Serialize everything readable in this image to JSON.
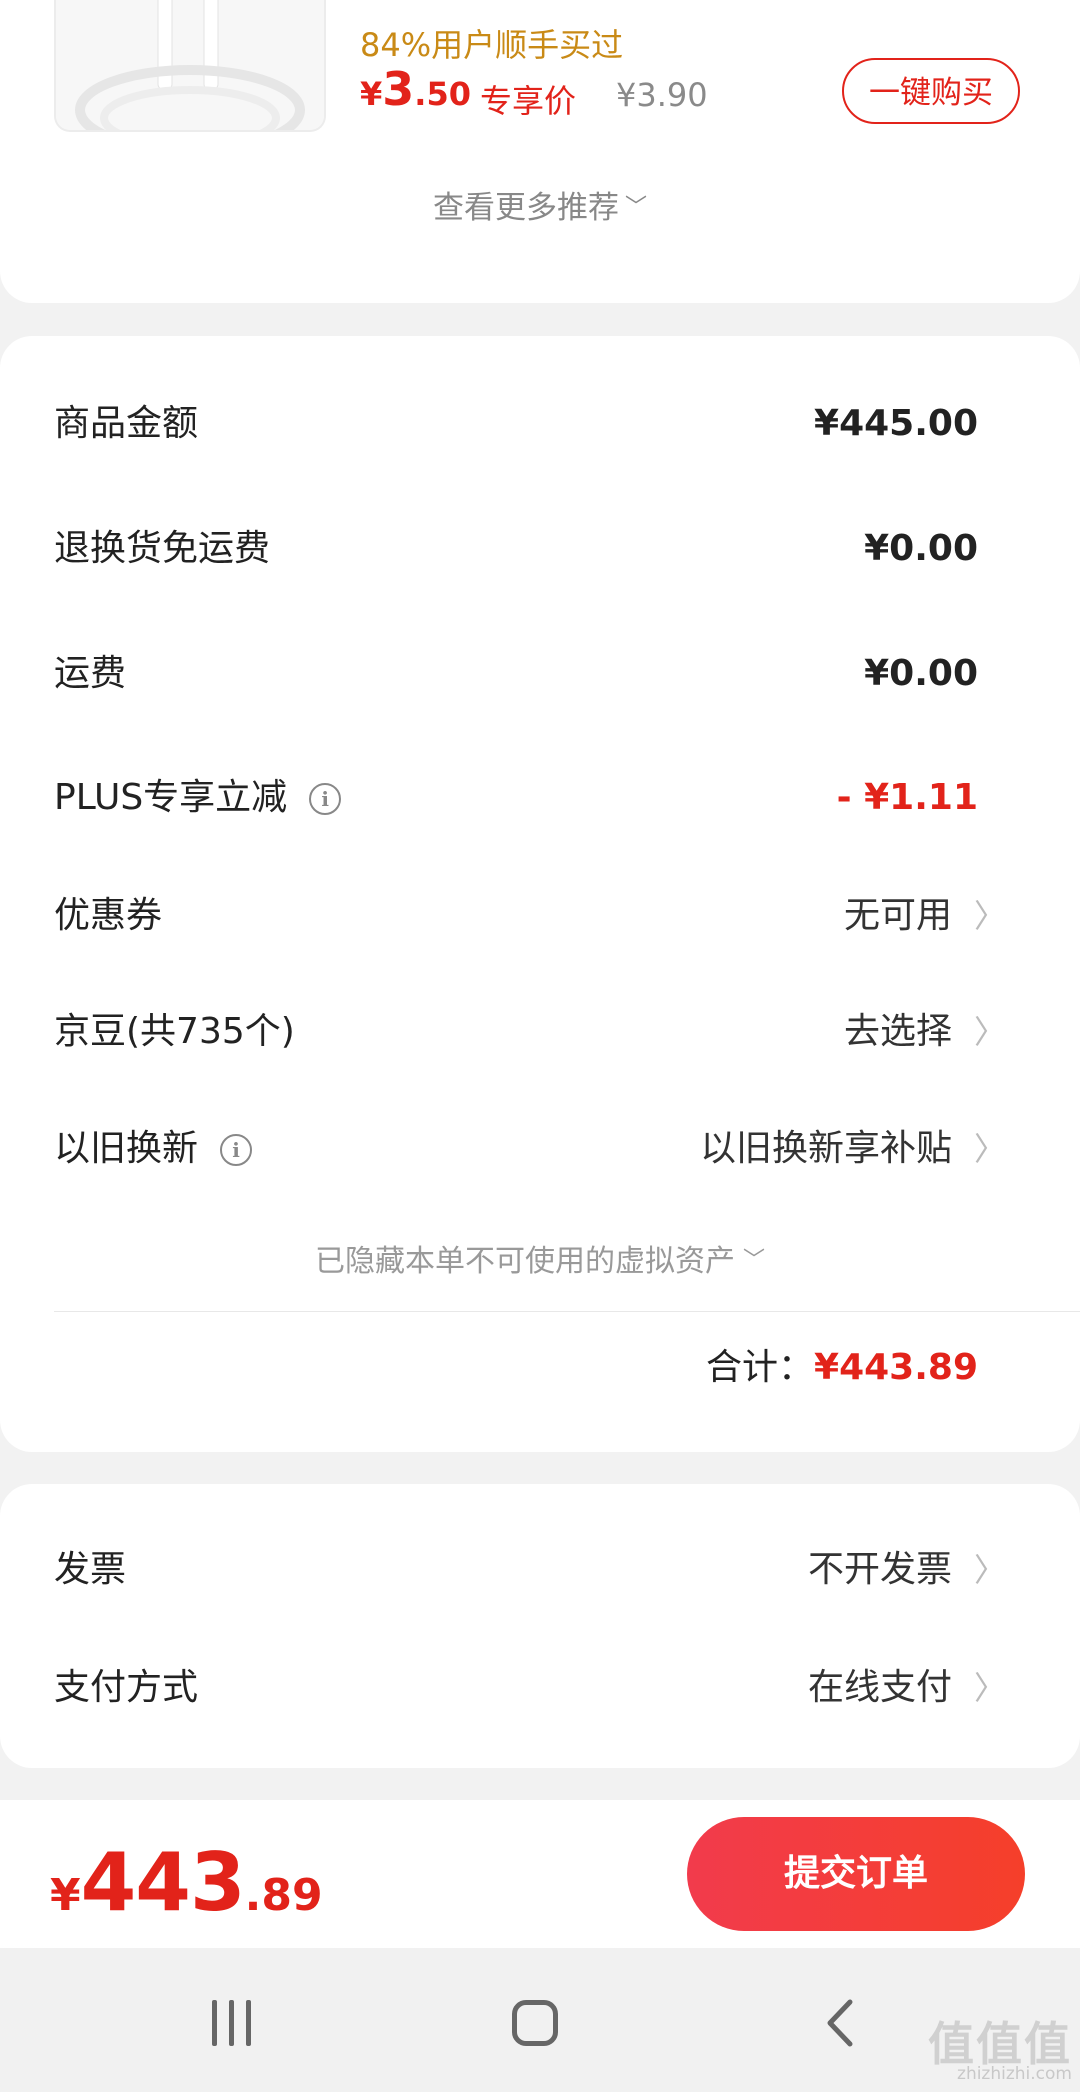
{
  "recommend": {
    "buyer_percent": "84%用户顺手买过",
    "price_symbol": "¥",
    "price_int": "3",
    "price_dec": ".50",
    "exclusive_label": "专享价",
    "original_price": "¥3.90",
    "buy_button": "一键购买",
    "more_label": "查看更多推荐"
  },
  "summary": {
    "rows": [
      {
        "label": "商品金额",
        "value": "¥445.00"
      },
      {
        "label": "退换货免运费",
        "value": "¥0.00"
      },
      {
        "label": "运费",
        "value": "¥0.00"
      },
      {
        "label": "PLUS专享立减",
        "value": "- ¥1.11"
      },
      {
        "label": "优惠券",
        "value": "无可用"
      },
      {
        "label": "京豆(共735个)",
        "value": "去选择"
      },
      {
        "label": "以旧换新",
        "value": "以旧换新享补贴"
      }
    ],
    "hidden_assets": "已隐藏本单不可使用的虚拟资产",
    "total_label": "合计：",
    "total_value": "¥443.89"
  },
  "invoice": {
    "rows": [
      {
        "label": "发票",
        "value": "不开发票"
      },
      {
        "label": "支付方式",
        "value": "在线支付"
      }
    ]
  },
  "submit": {
    "price_symbol": "¥",
    "price_int": "443",
    "price_dec": ".89",
    "button": "提交订单"
  },
  "watermark": {
    "text": "值值值",
    "sub": "zhizhizhi.com"
  },
  "colors": {
    "accent": "#e2231a",
    "orange": "#c98a16"
  }
}
